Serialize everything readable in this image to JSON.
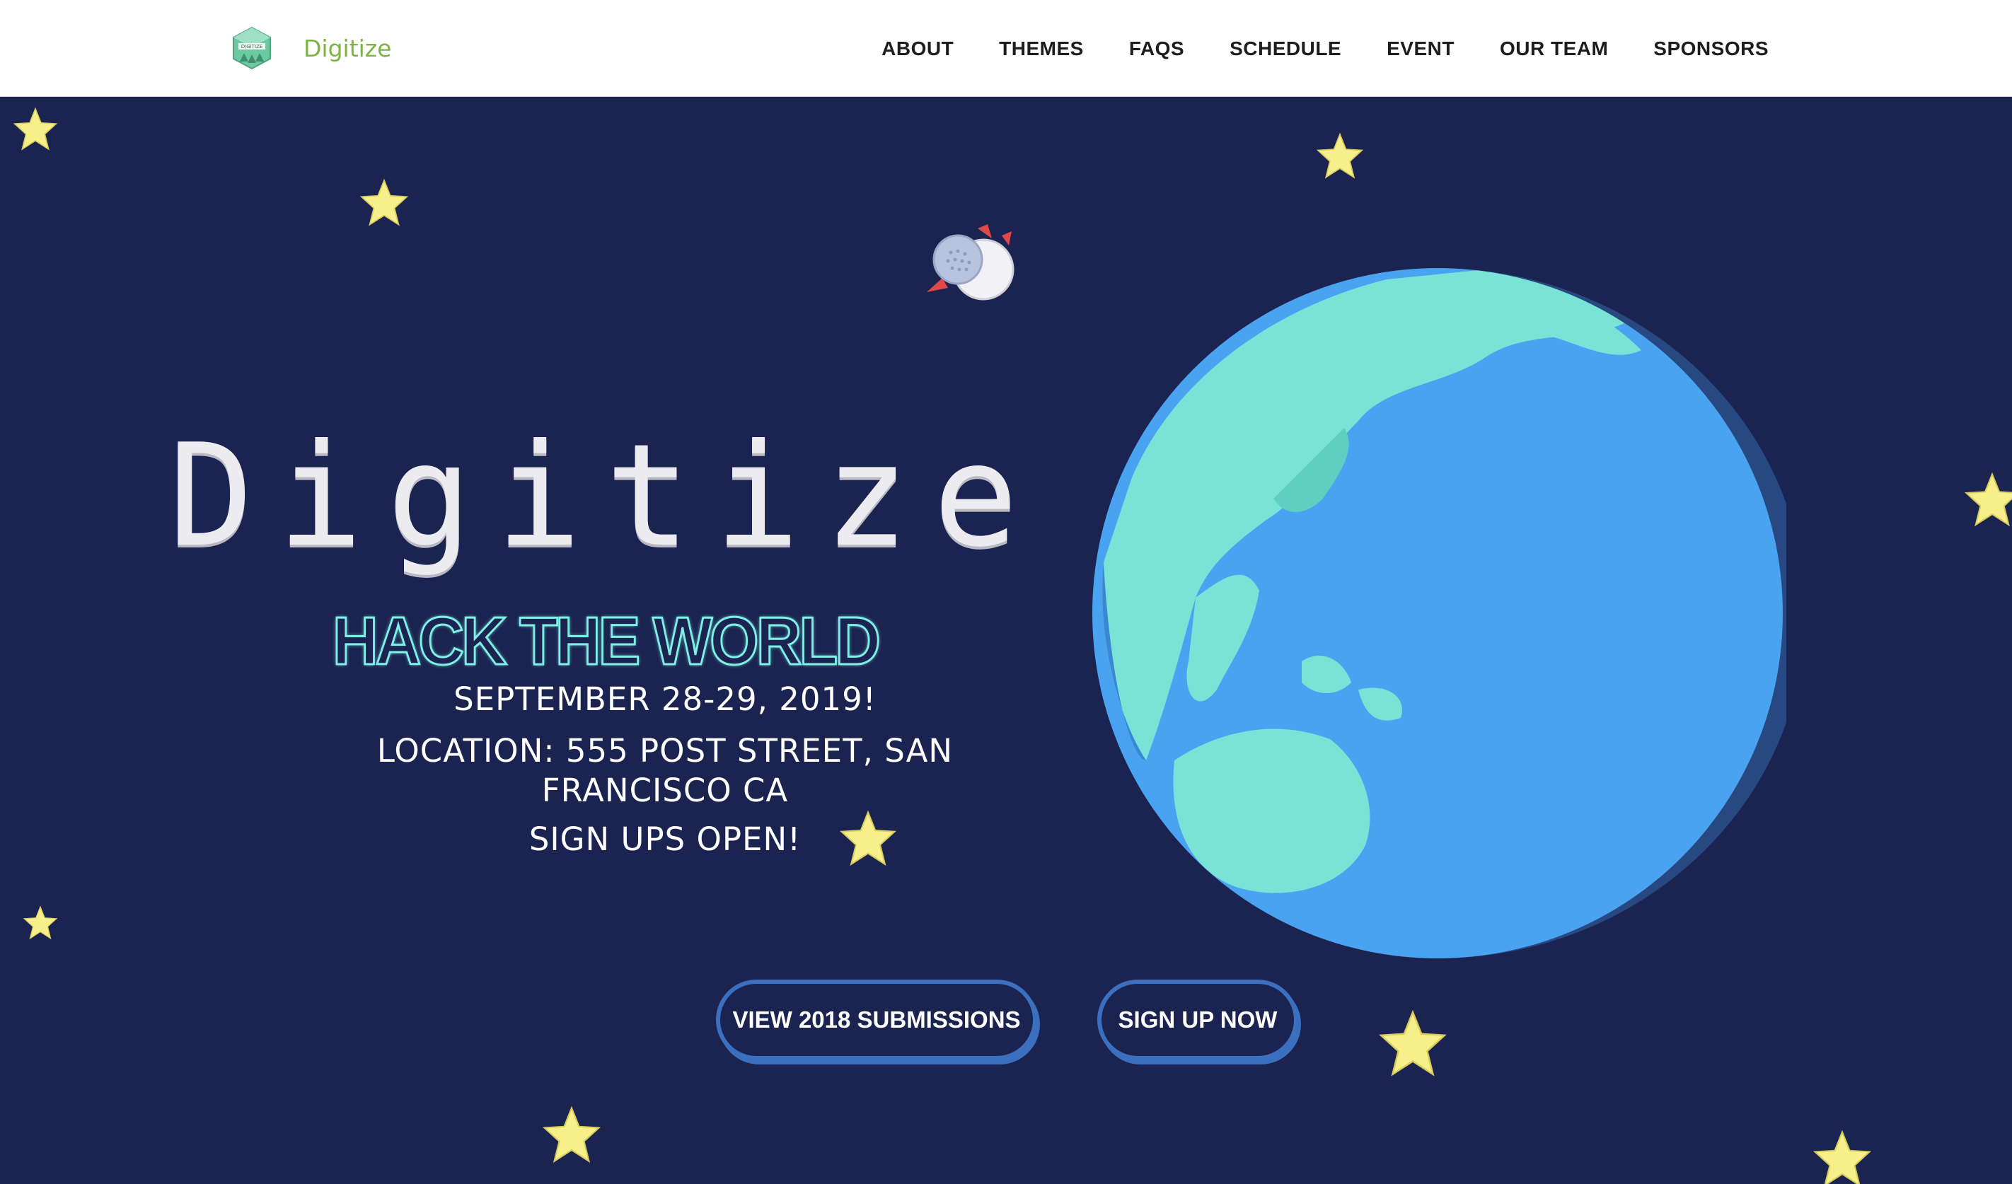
{
  "brand": {
    "name": "Digitize",
    "logo_text": "DIGITIZE"
  },
  "nav": {
    "items": [
      "ABOUT",
      "THEMES",
      "FAQS",
      "SCHEDULE",
      "EVENT",
      "OUR TEAM",
      "SPONSORS"
    ]
  },
  "hero": {
    "title": "Digitize",
    "tagline": "HACK THE WORLD",
    "date": "SEPTEMBER 28-29, 2019!",
    "location": "LOCATION: 555 POST STREET, SAN FRANCISCO CA",
    "signups": "SIGN UPS OPEN!"
  },
  "buttons": {
    "submissions": "VIEW 2018 SUBMISSIONS",
    "signup": "SIGN UP NOW"
  },
  "colors": {
    "background": "#1b2350",
    "brand_green": "#7cb342",
    "ocean": "#4aa3f0",
    "land": "#7ae3d6",
    "button_border": "#3b6fc0",
    "star": "#f7ef8a"
  },
  "icons": [
    "star-icon",
    "earth-icon",
    "satellite-icon",
    "digitize-logo-icon"
  ]
}
